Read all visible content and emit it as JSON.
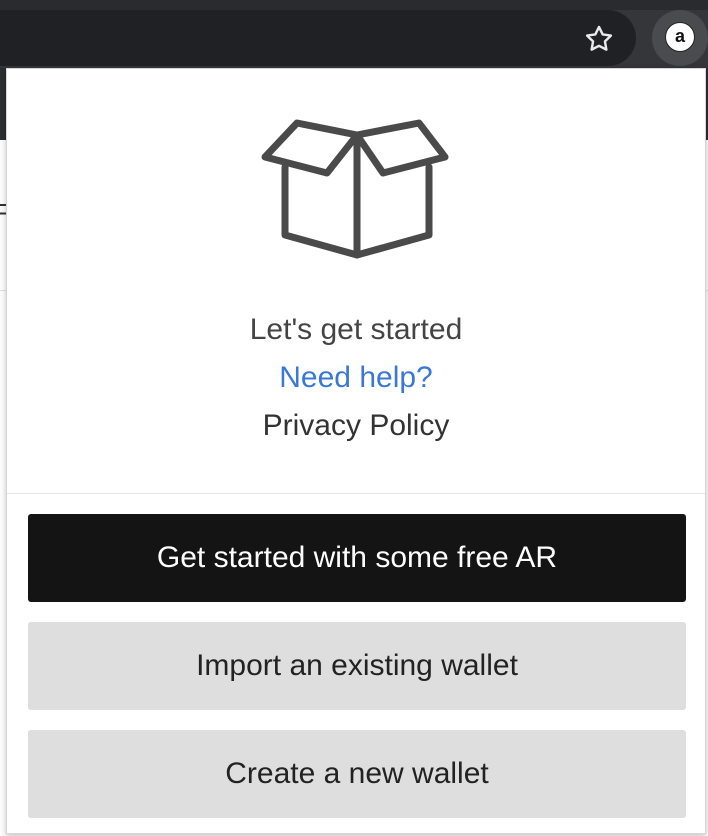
{
  "browser": {
    "star_icon": "star-outline-icon",
    "extension_badge": "a"
  },
  "popup": {
    "hero_icon": "open-box-icon",
    "title": "Let's get started",
    "help_link": "Need help?",
    "privacy_link": "Privacy Policy",
    "buttons": {
      "primary": "Get started with some free AR",
      "import": "Import an existing wallet",
      "create": "Create a new wallet"
    }
  },
  "colors": {
    "toolbar": "#35363a",
    "link": "#3a78d8",
    "primary_button": "#141414",
    "secondary_button": "#dedede"
  }
}
